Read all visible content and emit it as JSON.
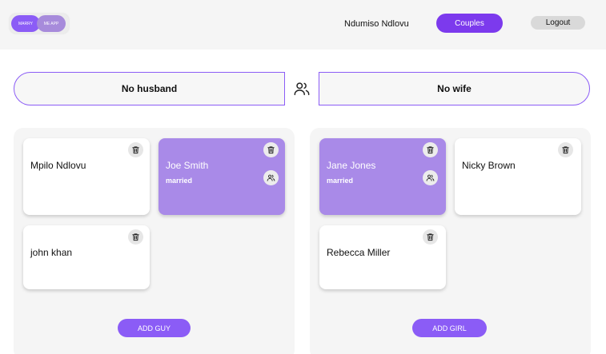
{
  "header": {
    "logo_left": "MARRY",
    "logo_right": "ME APP",
    "user_name": "Ndumiso Ndlovu",
    "couples_label": "Couples",
    "logout_label": "Logout"
  },
  "pairing": {
    "husband_slot": "No husband",
    "wife_slot": "No wife",
    "link_icon": "users-icon"
  },
  "guys": {
    "cards": [
      {
        "name": "Mpilo Ndlovu",
        "status": ""
      },
      {
        "name": "Joe Smith",
        "status": "married"
      },
      {
        "name": "john khan",
        "status": ""
      }
    ],
    "add_label": "ADD GUY"
  },
  "girls": {
    "cards": [
      {
        "name": "Jane Jones",
        "status": "married"
      },
      {
        "name": "Nicky Brown",
        "status": ""
      },
      {
        "name": "Rebecca Miller",
        "status": ""
      }
    ],
    "add_label": "ADD GIRL"
  },
  "colors": {
    "accent": "#7c3aed",
    "married_card": "#a98ae8",
    "panel_bg": "#f5f5f5"
  }
}
